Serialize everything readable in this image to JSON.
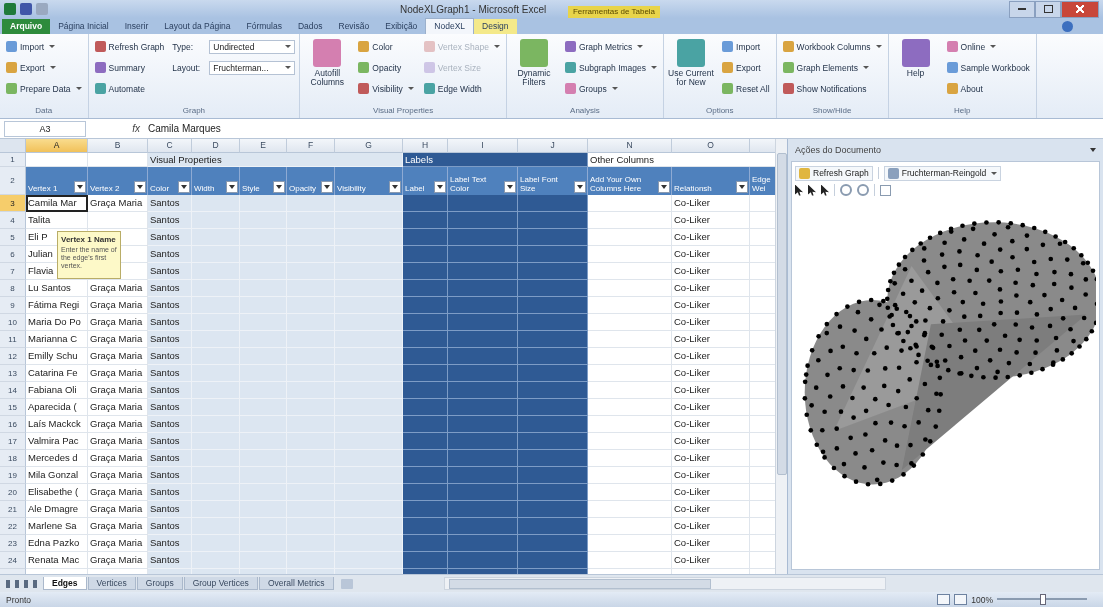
{
  "window": {
    "title": "NodeXLGraph1 - Microsoft Excel",
    "contextual_group": "Ferramentas de Tabela"
  },
  "ribbon_tabs": [
    {
      "label": "Arquivo",
      "kind": "file",
      "selected": false
    },
    {
      "label": "Página Inicial",
      "kind": "tab",
      "selected": false
    },
    {
      "label": "Inserir",
      "kind": "tab",
      "selected": false
    },
    {
      "label": "Layout da Página",
      "kind": "tab",
      "selected": false
    },
    {
      "label": "Fórmulas",
      "kind": "tab",
      "selected": false
    },
    {
      "label": "Dados",
      "kind": "tab",
      "selected": false
    },
    {
      "label": "Revisão",
      "kind": "tab",
      "selected": false
    },
    {
      "label": "Exibição",
      "kind": "tab",
      "selected": false
    },
    {
      "label": "NodeXL",
      "kind": "tab",
      "selected": true
    },
    {
      "label": "Design",
      "kind": "contextual",
      "selected": false
    }
  ],
  "ribbon_groups": [
    {
      "label": "Data",
      "columns": [
        [
          {
            "kind": "small",
            "label": "Import",
            "menu": true,
            "disabled": false
          },
          {
            "kind": "small",
            "label": "Export",
            "menu": true,
            "disabled": false
          },
          {
            "kind": "small",
            "label": "Prepare Data",
            "menu": true,
            "disabled": false
          }
        ]
      ]
    },
    {
      "label": "Graph",
      "columns": [
        [
          {
            "kind": "small",
            "label": "Refresh Graph",
            "menu": false,
            "disabled": false
          },
          {
            "kind": "small",
            "label": "Summary",
            "menu": false,
            "disabled": false
          },
          {
            "kind": "small",
            "label": "Automate",
            "menu": false,
            "disabled": false
          }
        ],
        [
          {
            "kind": "combo",
            "label": "Type:",
            "value": "Undirected",
            "menu": true,
            "disabled": false
          },
          {
            "kind": "combo",
            "label": "Layout:",
            "value": "Fruchterman...",
            "menu": true,
            "disabled": false
          }
        ]
      ]
    },
    {
      "label": "Visual Properties",
      "columns": [
        [
          {
            "kind": "large",
            "label": "Autofill Columns",
            "menu": false,
            "disabled": false
          }
        ],
        [
          {
            "kind": "small",
            "label": "Color",
            "menu": false,
            "disabled": false
          },
          {
            "kind": "small",
            "label": "Opacity",
            "menu": false,
            "disabled": false
          },
          {
            "kind": "small",
            "label": "Visibility",
            "menu": true,
            "disabled": false
          }
        ],
        [
          {
            "kind": "small",
            "label": "Vertex Shape",
            "menu": true,
            "disabled": true
          },
          {
            "kind": "small",
            "label": "Vertex Size",
            "menu": false,
            "disabled": true
          },
          {
            "kind": "small",
            "label": "Edge Width",
            "menu": false,
            "disabled": false
          }
        ]
      ]
    },
    {
      "label": "Analysis",
      "columns": [
        [
          {
            "kind": "large",
            "label": "Dynamic Filters",
            "menu": false,
            "disabled": false
          }
        ],
        [
          {
            "kind": "small",
            "label": "Graph Metrics",
            "menu": true,
            "disabled": false
          },
          {
            "kind": "small",
            "label": "Subgraph Images",
            "menu": true,
            "disabled": false
          },
          {
            "kind": "small",
            "label": "Groups",
            "menu": true,
            "disabled": false
          }
        ]
      ]
    },
    {
      "label": "Options",
      "columns": [
        [
          {
            "kind": "large",
            "label": "Use Current for New",
            "menu": false,
            "disabled": false
          }
        ],
        [
          {
            "kind": "small",
            "label": "Import",
            "menu": false,
            "disabled": false
          },
          {
            "kind": "small",
            "label": "Export",
            "menu": false,
            "disabled": false
          },
          {
            "kind": "small",
            "label": "Reset All",
            "menu": false,
            "disabled": false
          }
        ]
      ]
    },
    {
      "label": "Show/Hide",
      "columns": [
        [
          {
            "kind": "small",
            "label": "Workbook Columns",
            "menu": true,
            "disabled": false
          },
          {
            "kind": "small",
            "label": "Graph Elements",
            "menu": true,
            "disabled": false
          },
          {
            "kind": "small",
            "label": "Show Notifications",
            "menu": false,
            "disabled": false
          }
        ]
      ]
    },
    {
      "label": "Help",
      "columns": [
        [
          {
            "kind": "large",
            "label": "Help",
            "menu": false,
            "disabled": false
          }
        ],
        [
          {
            "kind": "small",
            "label": "Online",
            "menu": true,
            "disabled": false
          },
          {
            "kind": "small",
            "label": "Sample Workbook",
            "menu": false,
            "disabled": false
          },
          {
            "kind": "small",
            "label": "About",
            "menu": false,
            "disabled": false
          }
        ]
      ]
    }
  ],
  "formula_bar": {
    "name_box": "A3",
    "fx": "fx",
    "content": "Camila Marques"
  },
  "sheet": {
    "columns": [
      {
        "letter": "A",
        "selected": true
      },
      {
        "letter": "B",
        "selected": false
      },
      {
        "letter": "C",
        "selected": false
      },
      {
        "letter": "D",
        "selected": false
      },
      {
        "letter": "E",
        "selected": false
      },
      {
        "letter": "F",
        "selected": false
      },
      {
        "letter": "G",
        "selected": false
      },
      {
        "letter": "H",
        "selected": false
      },
      {
        "letter": "I",
        "selected": false
      },
      {
        "letter": "J",
        "selected": false
      },
      {
        "letter": "N",
        "selected": false
      },
      {
        "letter": "O",
        "selected": false
      }
    ],
    "band_row": {
      "number": "1",
      "bands": [
        "Visual Properties",
        "Labels",
        "Other Columns"
      ]
    },
    "header_row": {
      "number": "2",
      "headers": [
        {
          "text": "Vertex 1",
          "filter": true
        },
        {
          "text": "Vertex 2",
          "filter": true
        },
        {
          "text": "Color",
          "filter": true
        },
        {
          "text": "Width",
          "filter": true
        },
        {
          "text": "Style",
          "filter": true
        },
        {
          "text": "Opacity",
          "filter": true
        },
        {
          "text": "Visibility",
          "filter": true
        },
        {
          "text": "Label",
          "filter": true
        },
        {
          "text": "Label Text Color",
          "filter": true
        },
        {
          "text": "Label Font Size",
          "filter": true
        },
        {
          "text": "Add Your Own Columns Here",
          "filter": true
        },
        {
          "text": "Relationsh",
          "filter": true
        },
        {
          "text": "Edge Wei",
          "filter": false
        }
      ]
    },
    "rows": [
      {
        "number": "3",
        "selected": true,
        "vertex_1": "Camila Mar",
        "vertex_2": "Graça Maria",
        "column_c": "Santos",
        "relationship": "Co-Liker"
      },
      {
        "number": "4",
        "selected": false,
        "vertex_1": "Talita",
        "column_c": "Santos",
        "relationship": "Co-Liker"
      },
      {
        "number": "5",
        "selected": false,
        "vertex_1": "Eli P",
        "column_c": "Santos",
        "relationship": "Co-Liker"
      },
      {
        "number": "6",
        "selected": false,
        "vertex_1": "Julian",
        "column_c": "Santos",
        "relationship": "Co-Liker"
      },
      {
        "number": "7",
        "selected": false,
        "vertex_1": "Flavia",
        "column_c": "Santos",
        "relationship": "Co-Liker"
      },
      {
        "number": "8",
        "selected": false,
        "vertex_1": "Lu Santos",
        "vertex_2": "Graça Maria",
        "column_c": "Santos",
        "relationship": "Co-Liker"
      },
      {
        "number": "9",
        "selected": false,
        "vertex_1": "Fátima Regi",
        "vertex_2": "Graça Maria",
        "column_c": "Santos",
        "relationship": "Co-Liker"
      },
      {
        "number": "10",
        "selected": false,
        "vertex_1": "Maria Do Po",
        "vertex_2": "Graça Maria",
        "column_c": "Santos",
        "relationship": "Co-Liker"
      },
      {
        "number": "11",
        "selected": false,
        "vertex_1": "Marianna C",
        "vertex_2": "Graça Maria",
        "column_c": "Santos",
        "relationship": "Co-Liker"
      },
      {
        "number": "12",
        "selected": false,
        "vertex_1": "Emilly Schu",
        "vertex_2": "Graça Maria",
        "column_c": "Santos",
        "relationship": "Co-Liker"
      },
      {
        "number": "13",
        "selected": false,
        "vertex_1": "Catarina Fe",
        "vertex_2": "Graça Maria",
        "column_c": "Santos",
        "relationship": "Co-Liker"
      },
      {
        "number": "14",
        "selected": false,
        "vertex_1": "Fabiana Oli",
        "vertex_2": "Graça Maria",
        "column_c": "Santos",
        "relationship": "Co-Liker"
      },
      {
        "number": "15",
        "selected": false,
        "vertex_1": "Aparecida (",
        "vertex_2": "Graça Maria",
        "column_c": "Santos",
        "relationship": "Co-Liker"
      },
      {
        "number": "16",
        "selected": false,
        "vertex_1": "Laís Mackck",
        "vertex_2": "Graça Maria",
        "column_c": "Santos",
        "relationship": "Co-Liker"
      },
      {
        "number": "17",
        "selected": false,
        "vertex_1": "Valmira Pac",
        "vertex_2": "Graça Maria",
        "column_c": "Santos",
        "relationship": "Co-Liker"
      },
      {
        "number": "18",
        "selected": false,
        "vertex_1": "Mercedes d",
        "vertex_2": "Graça Maria",
        "column_c": "Santos",
        "relationship": "Co-Liker"
      },
      {
        "number": "19",
        "selected": false,
        "vertex_1": "Mila Gonzal",
        "vertex_2": "Graça Maria",
        "column_c": "Santos",
        "relationship": "Co-Liker"
      },
      {
        "number": "20",
        "selected": false,
        "vertex_1": "Elisabethe (",
        "vertex_2": "Graça Maria",
        "column_c": "Santos",
        "relationship": "Co-Liker"
      },
      {
        "number": "21",
        "selected": false,
        "vertex_1": "Ale Dmagre",
        "vertex_2": "Graça Maria",
        "column_c": "Santos",
        "relationship": "Co-Liker"
      },
      {
        "number": "22",
        "selected": false,
        "vertex_1": "Marlene Sa",
        "vertex_2": "Graça Maria",
        "column_c": "Santos",
        "relationship": "Co-Liker"
      },
      {
        "number": "23",
        "selected": false,
        "vertex_1": "Edna Pazko",
        "vertex_2": "Graça Maria",
        "column_c": "Santos",
        "relationship": "Co-Liker"
      },
      {
        "number": "24",
        "selected": false,
        "vertex_1": "Renata Mac",
        "vertex_2": "Graça Maria",
        "column_c": "Santos",
        "relationship": "Co-Liker"
      }
    ],
    "tooltip": {
      "title": "Vertex 1 Name",
      "text": "Enter the name of the edge's first vertex."
    }
  },
  "task_pane": {
    "title": "Ações do Documento",
    "refresh_label": "Refresh Graph",
    "layout_value": "Fruchterman-Reingold"
  },
  "sheet_tabs": [
    {
      "label": "Edges",
      "selected": true
    },
    {
      "label": "Vertices",
      "selected": false
    },
    {
      "label": "Groups",
      "selected": false
    },
    {
      "label": "Group Vertices",
      "selected": false
    },
    {
      "label": "Overall Metrics",
      "selected": false
    }
  ],
  "status_bar": {
    "mode": "Pronto",
    "zoom": "100%",
    "zoom_slider": {
      "level": 0.5
    }
  }
}
